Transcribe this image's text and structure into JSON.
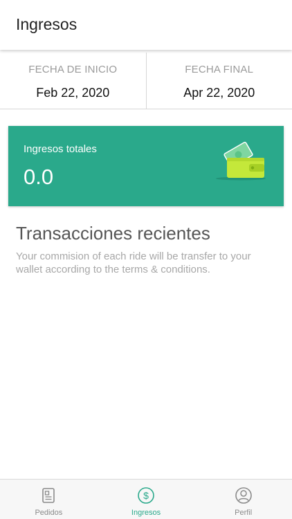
{
  "header": {
    "title": "Ingresos"
  },
  "date_range": {
    "start": {
      "label": "FECHA DE INICIO",
      "value": "Feb 22, 2020"
    },
    "end": {
      "label": "FECHA FINAL",
      "value": "Apr 22, 2020"
    }
  },
  "earnings": {
    "label": "Ingresos totales",
    "amount": "0.0",
    "icon": "wallet-icon",
    "card_color": "#2aa98b"
  },
  "transactions": {
    "title": "Transacciones recientes",
    "description": "Your commision of each ride will be transfer to your wallet according to the terms & conditions."
  },
  "tab_bar": {
    "active_color": "#2aa98b",
    "tabs": [
      {
        "label": "Pedidos",
        "icon": "orders-icon",
        "active": false
      },
      {
        "label": "Ingresos",
        "icon": "dollar-icon",
        "active": true
      },
      {
        "label": "Perfil",
        "icon": "profile-icon",
        "active": false
      }
    ]
  }
}
